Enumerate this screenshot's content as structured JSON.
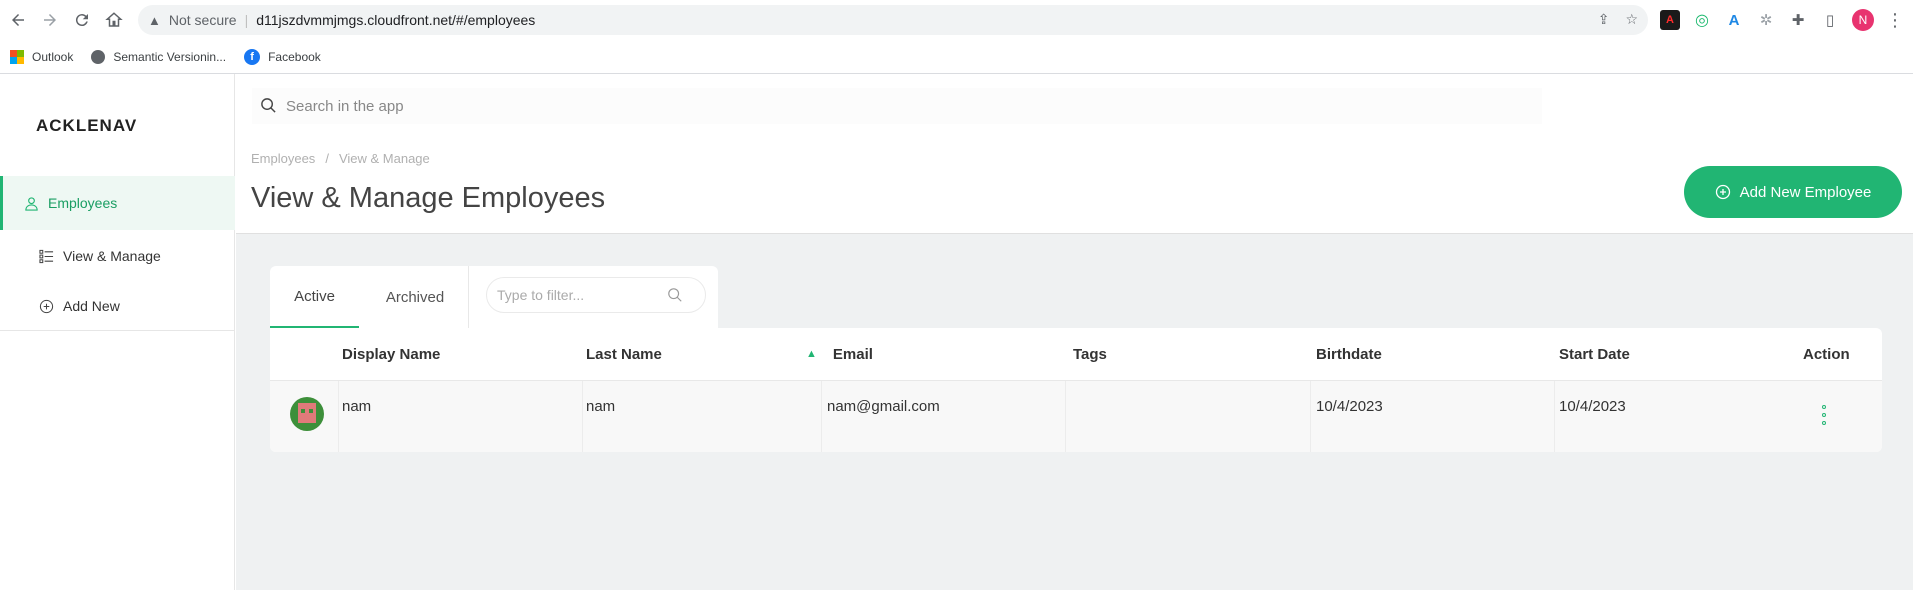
{
  "browser": {
    "security_label": "Not secure",
    "url": "d11jszdvmmjmgs.cloudfront.net/#/employees",
    "profile_initial": "N",
    "bookmarks": [
      {
        "label": "Outlook",
        "icon": "microsoft-icon"
      },
      {
        "label": "Semantic Versionin...",
        "icon": "globe-icon"
      },
      {
        "label": "Facebook",
        "icon": "facebook-icon"
      }
    ]
  },
  "sidebar": {
    "logo": "ACKLENAV",
    "items": [
      {
        "label": "Employees",
        "icon": "user-icon",
        "active": true
      },
      {
        "label": "View & Manage",
        "icon": "list-icon"
      },
      {
        "label": "Add New",
        "icon": "plus-circle-icon"
      }
    ]
  },
  "header": {
    "search_placeholder": "Search in the app",
    "breadcrumb": [
      "Employees",
      "View & Manage"
    ],
    "breadcrumb_sep": "/",
    "title": "View & Manage Employees",
    "add_button": "Add New Employee"
  },
  "tabs": {
    "items": [
      "Active",
      "Archived"
    ],
    "active": "Active",
    "filter_placeholder": "Type to filter..."
  },
  "table": {
    "columns": [
      "Display Name",
      "Last Name",
      "Email",
      "Tags",
      "Birthdate",
      "Start Date",
      "Action"
    ],
    "sorted_column": "Email",
    "rows": [
      {
        "display_name": "nam",
        "last_name": "nam",
        "email": "nam@gmail.com",
        "tags": "",
        "birthdate": "10/4/2023",
        "start_date": "10/4/2023"
      }
    ]
  },
  "colors": {
    "accent": "#21b573",
    "content_bg": "#eff1f2"
  }
}
